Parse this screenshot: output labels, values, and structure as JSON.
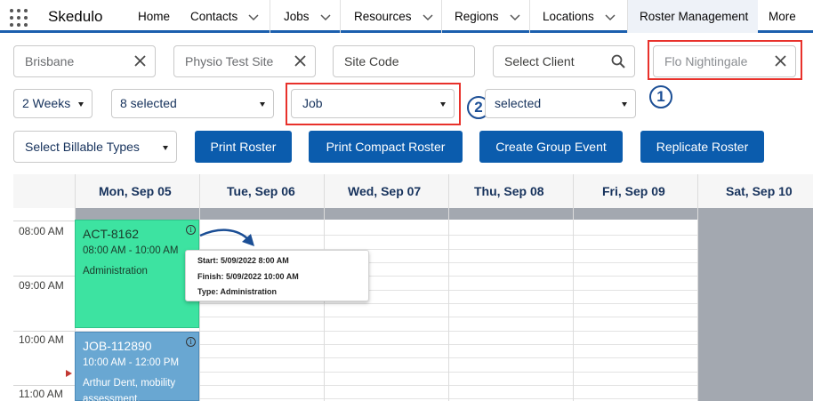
{
  "app": {
    "name": "Skedulo"
  },
  "nav": {
    "items": [
      {
        "label": "Home"
      },
      {
        "label": "Contacts"
      },
      {
        "label": "Jobs"
      },
      {
        "label": "Resources"
      },
      {
        "label": "Regions"
      },
      {
        "label": "Locations"
      },
      {
        "label": "Roster Management"
      },
      {
        "label": "More"
      }
    ]
  },
  "filters": {
    "region": "Brisbane",
    "site": "Physio Test Site",
    "site_code_placeholder": "Site Code",
    "client_placeholder": "Select Client",
    "resource_placeholder": "Flo Nightingale",
    "period": "2 Weeks",
    "multi_select": "8 selected",
    "type": "Job",
    "second_select": "selected",
    "billable": "Select Billable Types"
  },
  "annotations": {
    "badge1": "1",
    "badge2": "2"
  },
  "buttons": {
    "print_roster": "Print Roster",
    "print_compact": "Print Compact Roster",
    "group_event": "Create Group Event",
    "replicate": "Replicate Roster"
  },
  "calendar": {
    "days": [
      "Mon, Sep 05",
      "Tue, Sep 06",
      "Wed, Sep 07",
      "Thu, Sep 08",
      "Fri, Sep 09",
      "Sat, Sep 10"
    ],
    "times": [
      "08:00 AM",
      "09:00 AM",
      "10:00 AM",
      "11:00 AM"
    ],
    "events": [
      {
        "title": "ACT-8162",
        "time": "08:00 AM - 10:00 AM",
        "desc": "Administration",
        "color": "#3de3a1"
      },
      {
        "title": "JOB-112890",
        "time": "10:00 AM - 12:00 PM",
        "desc": "Arthur Dent, mobility assessment.",
        "color": "#69a7d2"
      }
    ],
    "tooltip": {
      "start": "Start: 5/09/2022 8:00 AM",
      "finish": "Finish: 5/09/2022 10:00 AM",
      "type": "Type: Administration"
    }
  },
  "colors": {
    "primary_button": "#0b5cad",
    "highlight": "#e8312b",
    "nav_accent": "#1b5fae"
  }
}
